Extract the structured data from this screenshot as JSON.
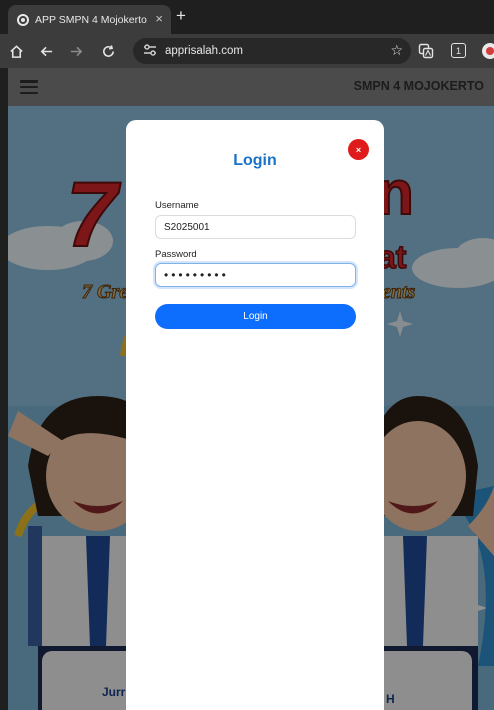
{
  "browser": {
    "tab_title": "APP SMPN 4 Mojokerto",
    "tab_close": "×",
    "new_tab": "+",
    "url": "apprisalah.com",
    "tab_count": "1"
  },
  "site": {
    "title": "SMPN 4 MOJOKERTO"
  },
  "hero": {
    "big_number": "7",
    "line1_right": "n",
    "line2_right": "at",
    "subtitle_left": "7 Gre",
    "subtitle_right": "ents",
    "card_left": "Jurr",
    "card_right": "H"
  },
  "login": {
    "title": "Login",
    "close_label": "×",
    "username_label": "Username",
    "username_value": "S2025001",
    "password_label": "Password",
    "password_value": "•••••••••",
    "submit_label": "Login"
  },
  "colors": {
    "accent": "#0d6efd",
    "title_blue": "#1a73c8",
    "close_red": "#e01b1b"
  }
}
